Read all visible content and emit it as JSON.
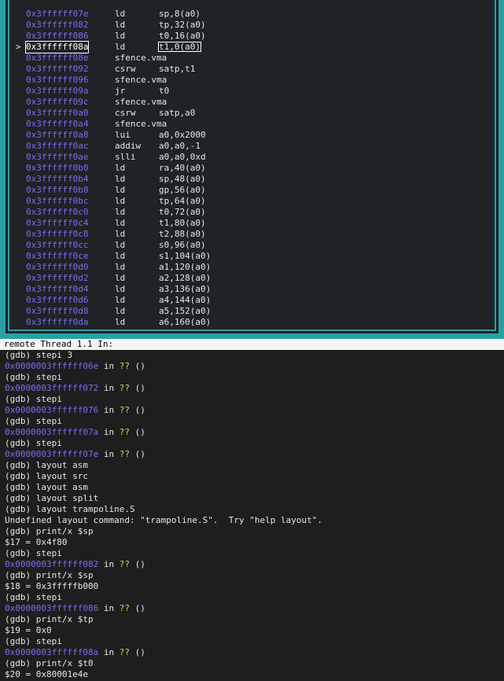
{
  "asm": {
    "current_marker": ">",
    "rows": [
      {
        "addr": "0x3ffffff07e",
        "mnem": "ld",
        "ops": "sp,8(a0)"
      },
      {
        "addr": "0x3ffffff082",
        "mnem": "ld",
        "ops": "tp,32(a0)"
      },
      {
        "addr": "0x3ffffff086",
        "mnem": "ld",
        "ops": "t0,16(a0)"
      },
      {
        "addr": "0x3ffffff08a",
        "mnem": "ld",
        "ops": "t1,0(a0)",
        "current": true
      },
      {
        "addr": "0x3ffffff08e",
        "mnem": "sfence.vma",
        "ops": ""
      },
      {
        "addr": "0x3ffffff092",
        "mnem": "csrw",
        "ops": "satp,t1"
      },
      {
        "addr": "0x3ffffff096",
        "mnem": "sfence.vma",
        "ops": ""
      },
      {
        "addr": "0x3ffffff09a",
        "mnem": "jr",
        "ops": "t0"
      },
      {
        "addr": "0x3ffffff09c",
        "mnem": "sfence.vma",
        "ops": ""
      },
      {
        "addr": "0x3ffffff0a0",
        "mnem": "csrw",
        "ops": "satp,a0"
      },
      {
        "addr": "0x3ffffff0a4",
        "mnem": "sfence.vma",
        "ops": ""
      },
      {
        "addr": "0x3ffffff0a8",
        "mnem": "lui",
        "ops": "a0,0x2000"
      },
      {
        "addr": "0x3ffffff0ac",
        "mnem": "addiw",
        "ops": "a0,a0,-1"
      },
      {
        "addr": "0x3ffffff0ae",
        "mnem": "slli",
        "ops": "a0,a0,0xd"
      },
      {
        "addr": "0x3ffffff0b0",
        "mnem": "ld",
        "ops": "ra,40(a0)"
      },
      {
        "addr": "0x3ffffff0b4",
        "mnem": "ld",
        "ops": "sp,48(a0)"
      },
      {
        "addr": "0x3ffffff0b8",
        "mnem": "ld",
        "ops": "gp,56(a0)"
      },
      {
        "addr": "0x3ffffff0bc",
        "mnem": "ld",
        "ops": "tp,64(a0)"
      },
      {
        "addr": "0x3ffffff0c0",
        "mnem": "ld",
        "ops": "t0,72(a0)"
      },
      {
        "addr": "0x3ffffff0c4",
        "mnem": "ld",
        "ops": "t1,80(a0)"
      },
      {
        "addr": "0x3ffffff0c8",
        "mnem": "ld",
        "ops": "t2,88(a0)"
      },
      {
        "addr": "0x3ffffff0cc",
        "mnem": "ld",
        "ops": "s0,96(a0)"
      },
      {
        "addr": "0x3ffffff0ce",
        "mnem": "ld",
        "ops": "s1,104(a0)"
      },
      {
        "addr": "0x3ffffff0d0",
        "mnem": "ld",
        "ops": "a1,120(a0)"
      },
      {
        "addr": "0x3ffffff0d2",
        "mnem": "ld",
        "ops": "a2,128(a0)"
      },
      {
        "addr": "0x3ffffff0d4",
        "mnem": "ld",
        "ops": "a3,136(a0)"
      },
      {
        "addr": "0x3ffffff0d6",
        "mnem": "ld",
        "ops": "a4,144(a0)"
      },
      {
        "addr": "0x3ffffff0d8",
        "mnem": "ld",
        "ops": "a5,152(a0)"
      },
      {
        "addr": "0x3ffffff0da",
        "mnem": "ld",
        "ops": "a6,160(a0)"
      }
    ]
  },
  "status_bar": {
    "text": "remote Thread 1.1 In:"
  },
  "console": {
    "lines": [
      {
        "type": "text",
        "text": "(gdb) stepi 3"
      },
      {
        "type": "loc",
        "addr": "0x0000003ffffff06e",
        "in": " in ",
        "q": "??",
        "rest": " ()"
      },
      {
        "type": "text",
        "text": "(gdb) stepi"
      },
      {
        "type": "loc",
        "addr": "0x0000003ffffff072",
        "in": " in ",
        "q": "??",
        "rest": " ()"
      },
      {
        "type": "text",
        "text": "(gdb) stepi"
      },
      {
        "type": "loc",
        "addr": "0x0000003ffffff076",
        "in": " in ",
        "q": "??",
        "rest": " ()"
      },
      {
        "type": "text",
        "text": "(gdb) stepi"
      },
      {
        "type": "loc",
        "addr": "0x0000003ffffff07a",
        "in": " in ",
        "q": "??",
        "rest": " ()"
      },
      {
        "type": "text",
        "text": "(gdb) stepi"
      },
      {
        "type": "loc",
        "addr": "0x0000003ffffff07e",
        "in": " in ",
        "q": "??",
        "rest": " ()"
      },
      {
        "type": "text",
        "text": "(gdb) layout asm"
      },
      {
        "type": "text",
        "text": "(gdb) layout src"
      },
      {
        "type": "text",
        "text": "(gdb) layout asm"
      },
      {
        "type": "text",
        "text": "(gdb) layout split"
      },
      {
        "type": "text",
        "text": "(gdb) layout trampoline.S"
      },
      {
        "type": "text",
        "text": "Undefined layout command: \"trampoline.S\".  Try \"help layout\"."
      },
      {
        "type": "text",
        "text": "(gdb) print/x $sp"
      },
      {
        "type": "text",
        "text": "$17 = 0x4f80"
      },
      {
        "type": "text",
        "text": "(gdb) stepi"
      },
      {
        "type": "loc",
        "addr": "0x0000003ffffff082",
        "in": " in ",
        "q": "??",
        "rest": " ()"
      },
      {
        "type": "text",
        "text": "(gdb) print/x $sp"
      },
      {
        "type": "text",
        "text": "$18 = 0x3fffffb000"
      },
      {
        "type": "text",
        "text": "(gdb) stepi"
      },
      {
        "type": "loc",
        "addr": "0x0000003ffffff086",
        "in": " in ",
        "q": "??",
        "rest": " ()"
      },
      {
        "type": "text",
        "text": "(gdb) print/x $tp"
      },
      {
        "type": "text",
        "text": "$19 = 0x0"
      },
      {
        "type": "text",
        "text": "(gdb) stepi"
      },
      {
        "type": "loc",
        "addr": "0x0000003ffffff08a",
        "in": " in ",
        "q": "??",
        "rest": " ()"
      },
      {
        "type": "text",
        "text": "(gdb) print/x $t0"
      },
      {
        "type": "text",
        "text": "$20 = 0x80001e4e"
      }
    ]
  }
}
